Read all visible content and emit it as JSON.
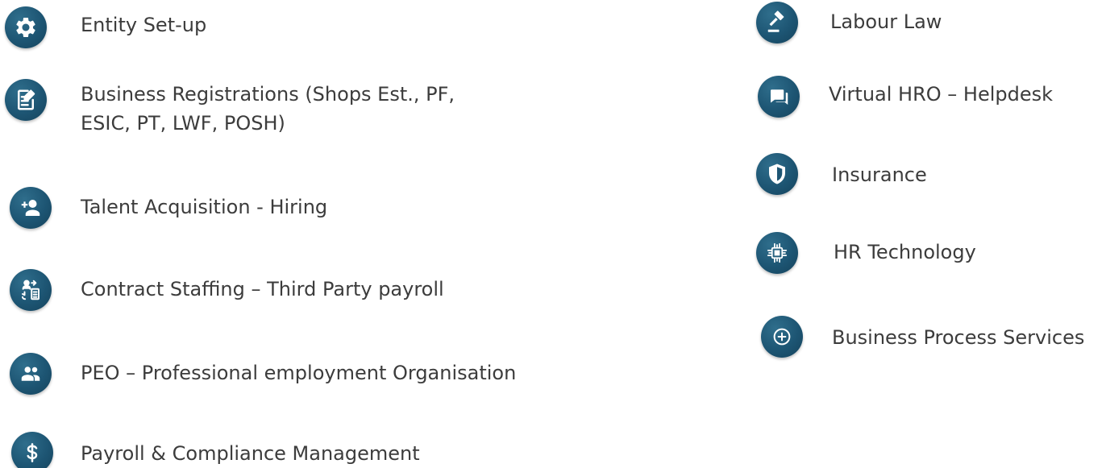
{
  "left_column": {
    "items": [
      {
        "label": "Entity Set-up",
        "icon": "gear-icon"
      },
      {
        "label_line1": "Business Registrations (Shops Est., PF,",
        "label_line2": "ESIC, PT, LWF, POSH)",
        "icon": "edit-document-icon"
      },
      {
        "label": "Talent Acquisition - Hiring",
        "icon": "add-user-icon"
      },
      {
        "label": "Contract Staffing – Third Party payroll",
        "icon": "staffing-exchange-icon"
      },
      {
        "label": "PEO – Professional employment Organisation",
        "icon": "group-icon"
      },
      {
        "label": "Payroll & Compliance Management",
        "icon": "dollar-icon"
      }
    ]
  },
  "right_column": {
    "items": [
      {
        "label": "Labour Law",
        "icon": "gavel-icon"
      },
      {
        "label": "Virtual HRO – Helpdesk",
        "icon": "chat-icon"
      },
      {
        "label": "Insurance",
        "icon": "shield-icon"
      },
      {
        "label": "HR Technology",
        "icon": "chip-icon"
      },
      {
        "label": "Business Process Services",
        "icon": "plus-circle-icon"
      }
    ]
  },
  "colors": {
    "icon_background": "#1d5573",
    "icon_foreground": "#ffffff",
    "text": "#3c3c3c"
  }
}
